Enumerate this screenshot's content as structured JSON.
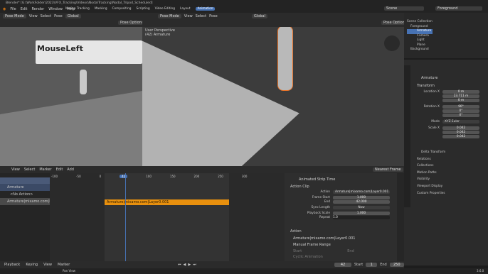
{
  "title": "Blender* [G:\\WorkFolder\\2023\\VFX_Tracking\\Videos\\NodalTracking\\Nodal_Tripod_Scheduled]",
  "menu": [
    "File",
    "Edit",
    "Render",
    "Window",
    "Help"
  ],
  "workspaces": [
    "Motion Tracking",
    "Masking",
    "Compositing",
    "Scripting",
    "Video Editing",
    "Layout",
    "Animation"
  ],
  "active_workspace": "Animation",
  "scene": "Scene",
  "view_layer": "Foreground",
  "left_vp": {
    "mode": "Pose Mode",
    "menus": [
      "View",
      "Select",
      "Pose"
    ],
    "transform": "Global",
    "options": "Pose Options",
    "overlay_text": "MouseLeft"
  },
  "main_vp": {
    "mode": "Pose Mode",
    "menus": [
      "View",
      "Select",
      "Pose"
    ],
    "transform": "Global",
    "options": "Pose Options",
    "info1": "User Perspective",
    "info2": "(42) Armature"
  },
  "outliner": {
    "items": [
      "Scene Collection",
      "Foreground",
      "Armature",
      "Camera",
      "Light",
      "Plane",
      "Background"
    ]
  },
  "props": {
    "object": "Armature",
    "section": "Transform",
    "location_label": "Location X",
    "loc": [
      "0 m",
      "23.711 m",
      "0 m"
    ],
    "rotation_label": "Rotation X",
    "rot": [
      "90°",
      "0°",
      "0°"
    ],
    "mode_label": "Mode",
    "mode": "XYZ Euler",
    "scale_label": "Scale X",
    "scale": [
      "0.042",
      "0.042",
      "0.042"
    ],
    "subsections": [
      "Delta Transform",
      "Relations",
      "Collections",
      "Motion Paths",
      "Visibility",
      "Viewport Display",
      "Custom Properties"
    ]
  },
  "nla": {
    "menus": [
      "View",
      "Select",
      "Marker",
      "Edit",
      "Add"
    ],
    "ticks": [
      "-100",
      "-50",
      "0",
      "42",
      "100",
      "150",
      "200",
      "250",
      "300"
    ],
    "current_frame": "42",
    "tracks": [
      "Armature",
      "<No Action>",
      "Armature|mixamo.com|Layer0.001"
    ],
    "strip": "Armature|mixamo.com|Layer0.001",
    "nearest": "Nearest Frame"
  },
  "strip_panel": {
    "header": "Animated Strip Time",
    "section": "Action Clip",
    "action_label": "Action",
    "action": "Armature|mixamo.com|Layer0.001",
    "frame_start_label": "Frame Start",
    "frame_start": "1.000",
    "end_label": "End",
    "end": "42.000",
    "sync_label": "Sync Length",
    "now": "Now",
    "playback_label": "Playback Scale",
    "playback": "1.000",
    "repeat_label": "Repeat",
    "repeat": "1.0",
    "section2": "Action",
    "action2": "Armature|mixamo.com|Layer0.001",
    "manual": "Manual Frame Range",
    "start_label": "Start",
    "end2_label": "End",
    "cyclic": "Cyclic Animation"
  },
  "timeline": {
    "menus": [
      "Playback",
      "Keying",
      "View",
      "Marker"
    ],
    "frame": "42",
    "start_label": "Start",
    "start": "1",
    "end_label": "End",
    "end": "250"
  },
  "status": {
    "hint": "Pan View",
    "version": "3.6.0"
  }
}
